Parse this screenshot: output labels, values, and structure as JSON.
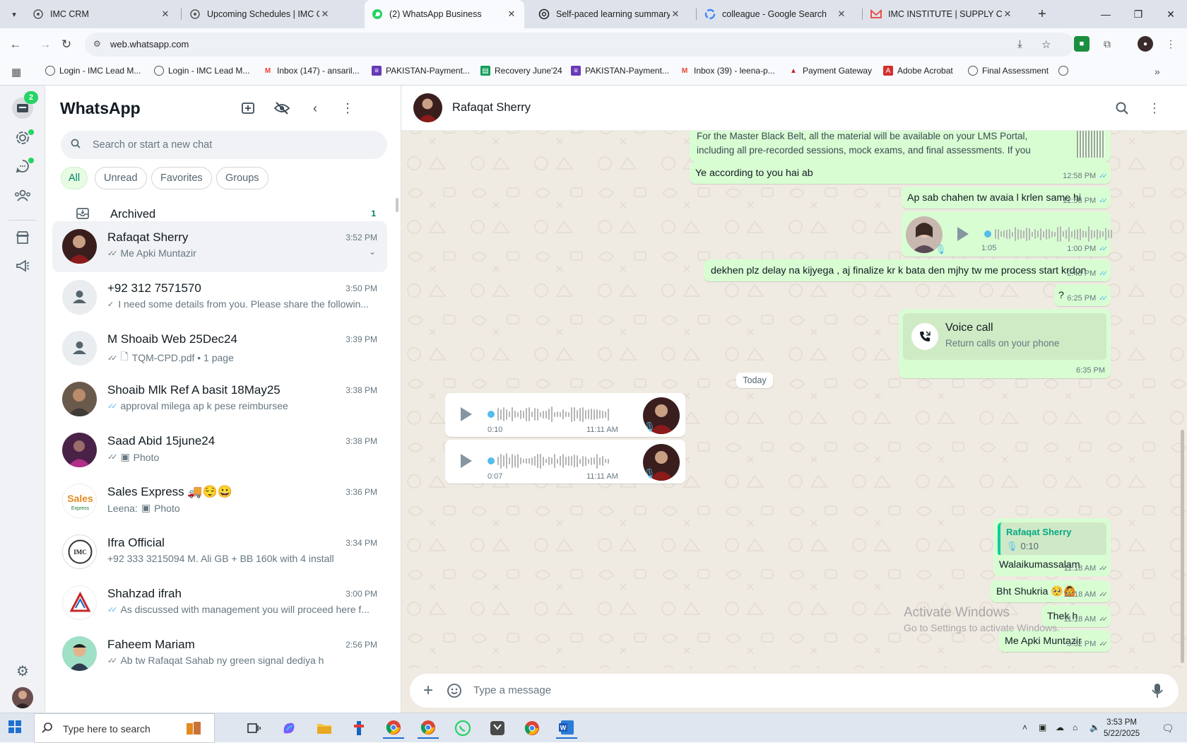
{
  "browser": {
    "tabs": [
      {
        "title": "IMC CRM",
        "icon": "imc-logo-icon"
      },
      {
        "title": "Upcoming Schedules | IMC Cer",
        "icon": "imc-logo-icon"
      },
      {
        "title": "(2) WhatsApp Business",
        "icon": "whatsapp-icon",
        "active": true
      },
      {
        "title": "Self-paced learning summary",
        "icon": "openai-icon"
      },
      {
        "title": "colleague - Google Search",
        "icon": "google-icon"
      },
      {
        "title": "IMC INSTITUTE | SUPPLY COM",
        "icon": "gmail-icon"
      }
    ],
    "url": "web.whatsapp.com",
    "bookmarks": [
      {
        "label": "Login - IMC Lead M...",
        "icon": "imc-logo-icon"
      },
      {
        "label": "Login - IMC Lead M...",
        "icon": "imc-logo-icon"
      },
      {
        "label": "Inbox (147) - ansaril...",
        "icon": "gmail-icon"
      },
      {
        "label": "PAKISTAN-Payment...",
        "icon": "forms-icon"
      },
      {
        "label": "Recovery June'24",
        "icon": "sheets-icon"
      },
      {
        "label": "PAKISTAN-Payment...",
        "icon": "forms-icon"
      },
      {
        "label": "Inbox (39) - leena-p...",
        "icon": "gmail-icon"
      },
      {
        "label": "Payment Gateway",
        "icon": "pg-icon"
      },
      {
        "label": "Adobe Acrobat",
        "icon": "acrobat-icon"
      },
      {
        "label": "Final Assessment",
        "icon": "imc-logo-icon"
      }
    ]
  },
  "rail": {
    "chats_badge": "2"
  },
  "sidebar": {
    "title": "WhatsApp",
    "search_placeholder": "Search or start a new chat",
    "filters": [
      "All",
      "Unread",
      "Favorites",
      "Groups"
    ],
    "archived_label": "Archived",
    "archived_count": "1",
    "chats": [
      {
        "name": "Rafaqat Sherry",
        "time": "3:52 PM",
        "preview": "Me Apki Muntazir",
        "tick": "read",
        "selected": true
      },
      {
        "name": "+92 312 7571570",
        "time": "3:50 PM",
        "preview": "I need some details from you. Please share the followin...",
        "tick": "sent"
      },
      {
        "name": "M Shoaib Web 25Dec24",
        "time": "3:39 PM",
        "preview": "TQM-CPD.pdf • 1 page",
        "tick": "delivered",
        "media": "doc"
      },
      {
        "name": "Shoaib Mlk Ref A basit 18May25",
        "time": "3:38 PM",
        "preview": "approval milega ap k pese reimbursee",
        "tick": "read"
      },
      {
        "name": "Saad Abid 15june24",
        "time": "3:38 PM",
        "preview": "Photo",
        "tick": "delivered",
        "media": "photo"
      },
      {
        "name": "Sales Express 🚚😌😀",
        "time": "3:36 PM",
        "preview": "Photo",
        "prefix": "Leena:",
        "media": "photo"
      },
      {
        "name": "Ifra Official",
        "time": "3:34 PM",
        "preview": "+92 333 3215094 M. Ali GB + BB 160k with 4 install"
      },
      {
        "name": "Shahzad ifrah",
        "time": "3:00 PM",
        "preview": "As discussed with management you will proceed here f...",
        "tick": "read"
      },
      {
        "name": "Faheem Mariam",
        "time": "2:56 PM",
        "preview": "Ab tw Rafaqat Sahab ny green signal dediya h",
        "tick": "delivered"
      }
    ]
  },
  "conversation": {
    "contact_name": "Rafaqat Sherry",
    "messages": {
      "m0_text": "For the Master Black Belt, all the material will be available on your LMS Portal, including all pre-recorded sessions, mock exams, and final assessments. If you choose the package of ...",
      "m1_text": "Ye according to you hai ab",
      "m1_time": "12:58 PM",
      "m2_text": "Ap sab chahen tw avaia l krlen same hi",
      "m2_time": "12:58 PM",
      "m3_duration": "1:05",
      "m3_time": "1:00 PM",
      "m4_text": "dekhen plz delay na kijyega , aj finalize kr k bata den mjhy tw me process start krdon",
      "m4_time": "2:48 PM",
      "m5_text": "?",
      "m5_time": "6:25 PM",
      "call_title": "Voice call",
      "call_sub": "Return calls on your phone",
      "call_time": "6:35 PM",
      "date_chip": "Today",
      "v1_duration": "0:10",
      "v1_time": "11:11 AM",
      "v2_duration": "0:07",
      "v2_time": "11:11 AM",
      "quote_name": "Rafaqat Sherry",
      "quote_duration": "0:10",
      "r1_text": "Walaikumassalam",
      "r1_time": "11:18 AM",
      "r2_text": "Bht Shukria 🥺🙆",
      "r2_time": "11:18 AM",
      "r3_text": "Thek h",
      "r3_time": "11:18 AM",
      "r4_text": "Me Apki Muntazir",
      "r4_time": "3:52 PM"
    },
    "composer_placeholder": "Type a message"
  },
  "watermark": {
    "line1": "Activate Windows",
    "line2": "Go to Settings to activate Windows."
  },
  "taskbar": {
    "search_placeholder": "Type here to search",
    "time": "3:53 PM",
    "date": "5/22/2025"
  },
  "colors": {
    "accent": "#008069",
    "outgoing_bubble": "#d9fdd3",
    "badge": "#25d366",
    "read_tick": "#53bdeb"
  }
}
